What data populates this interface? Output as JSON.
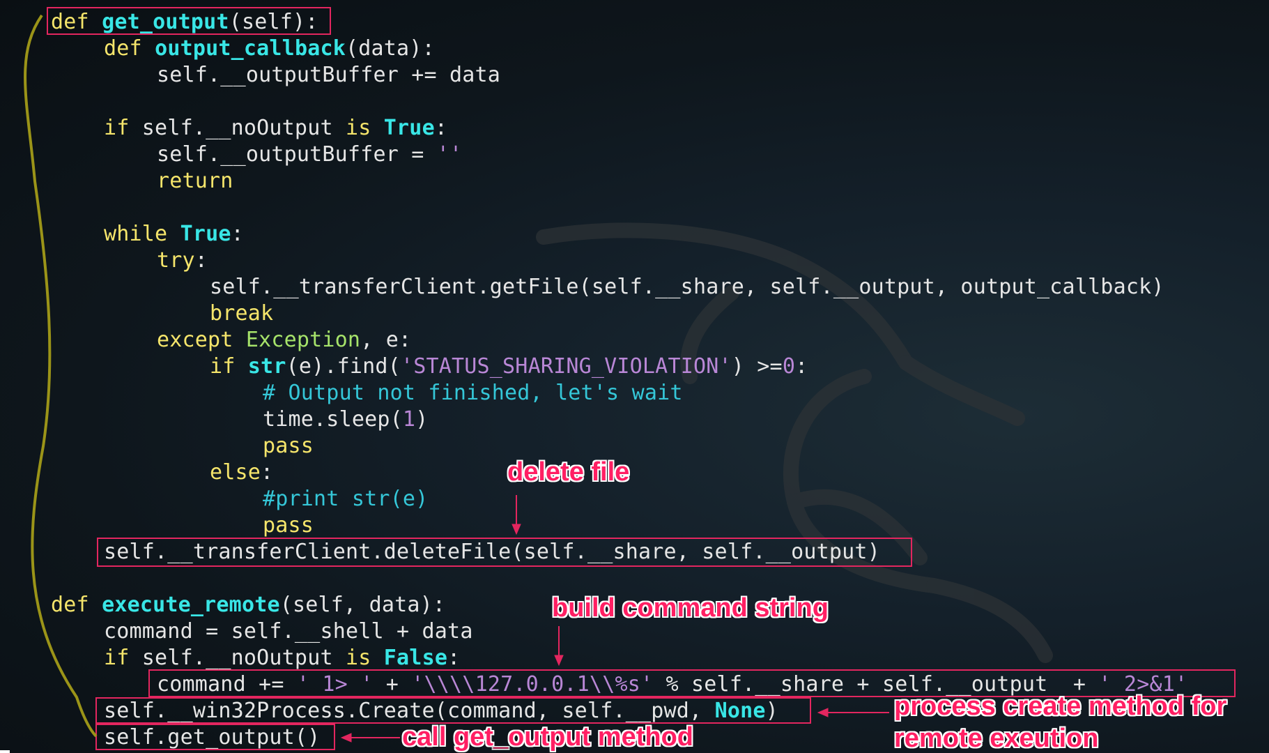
{
  "code": {
    "l1": {
      "kw": "def",
      "fn": "get_output",
      "rest": "(self):"
    },
    "l2": {
      "kw": "def",
      "fn": "output_callback",
      "rest": "(data):"
    },
    "l3": {
      "text": "self.__outputBuffer += data"
    },
    "l4": {
      "kw": "if",
      "a": " self.__noOutput ",
      "kw2": "is",
      "bi": "True",
      "rest": ":"
    },
    "l5": {
      "a": "self.__outputBuffer = ",
      "str": "''"
    },
    "l6": {
      "kw": "return"
    },
    "l7": {
      "kw": "while",
      "bi": "True",
      "rest": ":"
    },
    "l8": {
      "kw": "try",
      "rest": ":"
    },
    "l9": {
      "text": "self.__transferClient.getFile(self.__share, self.__output, output_callback)"
    },
    "l10": {
      "kw": "break"
    },
    "l11": {
      "kw": "except",
      "ex": "Exception",
      "rest": ", e:"
    },
    "l12": {
      "kw": "if",
      "bi": "str",
      "a": "(e).find(",
      "str": "'STATUS_SHARING_VIOLATION'",
      "b": ") >=",
      "num": "0",
      "rest": ":"
    },
    "l13": {
      "cm": "# Output not finished, let's wait"
    },
    "l14": {
      "a": "time.sleep(",
      "num": "1",
      "rest": ")"
    },
    "l15": {
      "kw": "pass"
    },
    "l16": {
      "kw": "else",
      "rest": ":"
    },
    "l17": {
      "cm": "#print str(e)"
    },
    "l18": {
      "kw": "pass"
    },
    "l19": {
      "text": "self.__transferClient.deleteFile(self.__share, self.__output)"
    },
    "l20": {
      "kw": "def",
      "fn": "execute_remote",
      "rest": "(self, data):"
    },
    "l21": {
      "text": "command = self.__shell + data"
    },
    "l22": {
      "kw": "if",
      "a": " self.__noOutput ",
      "kw2": "is",
      "bi": "False",
      "rest": ":"
    },
    "l23": {
      "a": "command += ",
      "s1": "' 1> '",
      "b": " + ",
      "s2": "'\\\\\\\\127.0.0.1\\\\%s'",
      "c": " % self.__share + self.__output  + ",
      "s3": "' 2>&1'"
    },
    "l24": {
      "a": "self.__win32Process.Create(command, self.__pwd, ",
      "bi": "None",
      "rest": ")"
    },
    "l25": {
      "text": "self.get_output()"
    }
  },
  "annotations": {
    "delete_file": "delete file",
    "build_command": "build command string",
    "process_create_1": "process create method for",
    "process_create_2": "remote exeution",
    "call_get_output": "call get_output method"
  },
  "colors": {
    "keyword": "#f5e56b",
    "function": "#39e6e6",
    "string": "#b987d6",
    "comment": "#35c7d8",
    "highlight_box": "#e3265f",
    "annotation": "#ff1f63",
    "bracket": "#9b9418"
  }
}
